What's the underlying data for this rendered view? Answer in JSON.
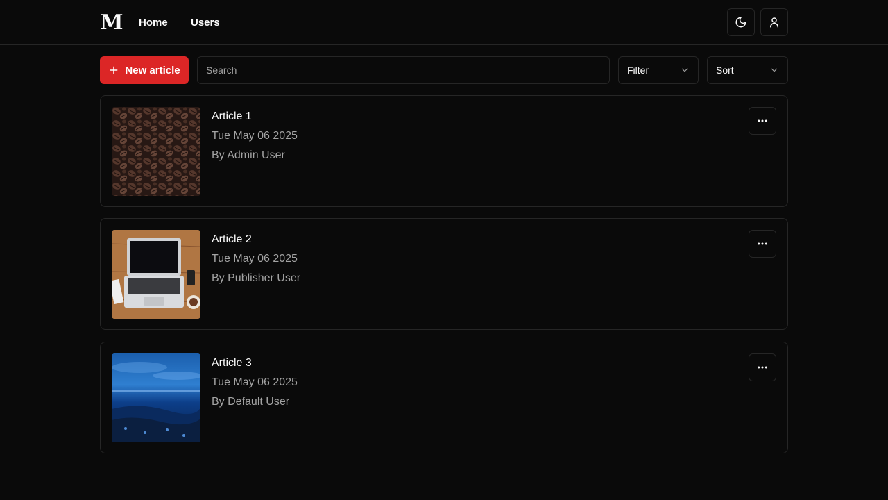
{
  "header": {
    "logo_text": "M",
    "nav": [
      {
        "label": "Home"
      },
      {
        "label": "Users"
      }
    ],
    "theme_icon": "moon-icon",
    "user_icon": "user-icon"
  },
  "toolbar": {
    "new_article_label": "New article",
    "search_placeholder": "Search",
    "search_value": "",
    "filter_label": "Filter",
    "sort_label": "Sort"
  },
  "colors": {
    "accent": "#dc2626",
    "background": "#0a0a0a",
    "border": "#262626",
    "muted_text": "#a3a3a3"
  },
  "articles": [
    {
      "title": "Article 1",
      "date": "Tue May 06 2025",
      "author": "By Admin User",
      "image": "coffee-beans"
    },
    {
      "title": "Article 2",
      "date": "Tue May 06 2025",
      "author": "By Publisher User",
      "image": "laptop-on-desk"
    },
    {
      "title": "Article 3",
      "date": "Tue May 06 2025",
      "author": "By Default User",
      "image": "blue-seascape"
    }
  ]
}
